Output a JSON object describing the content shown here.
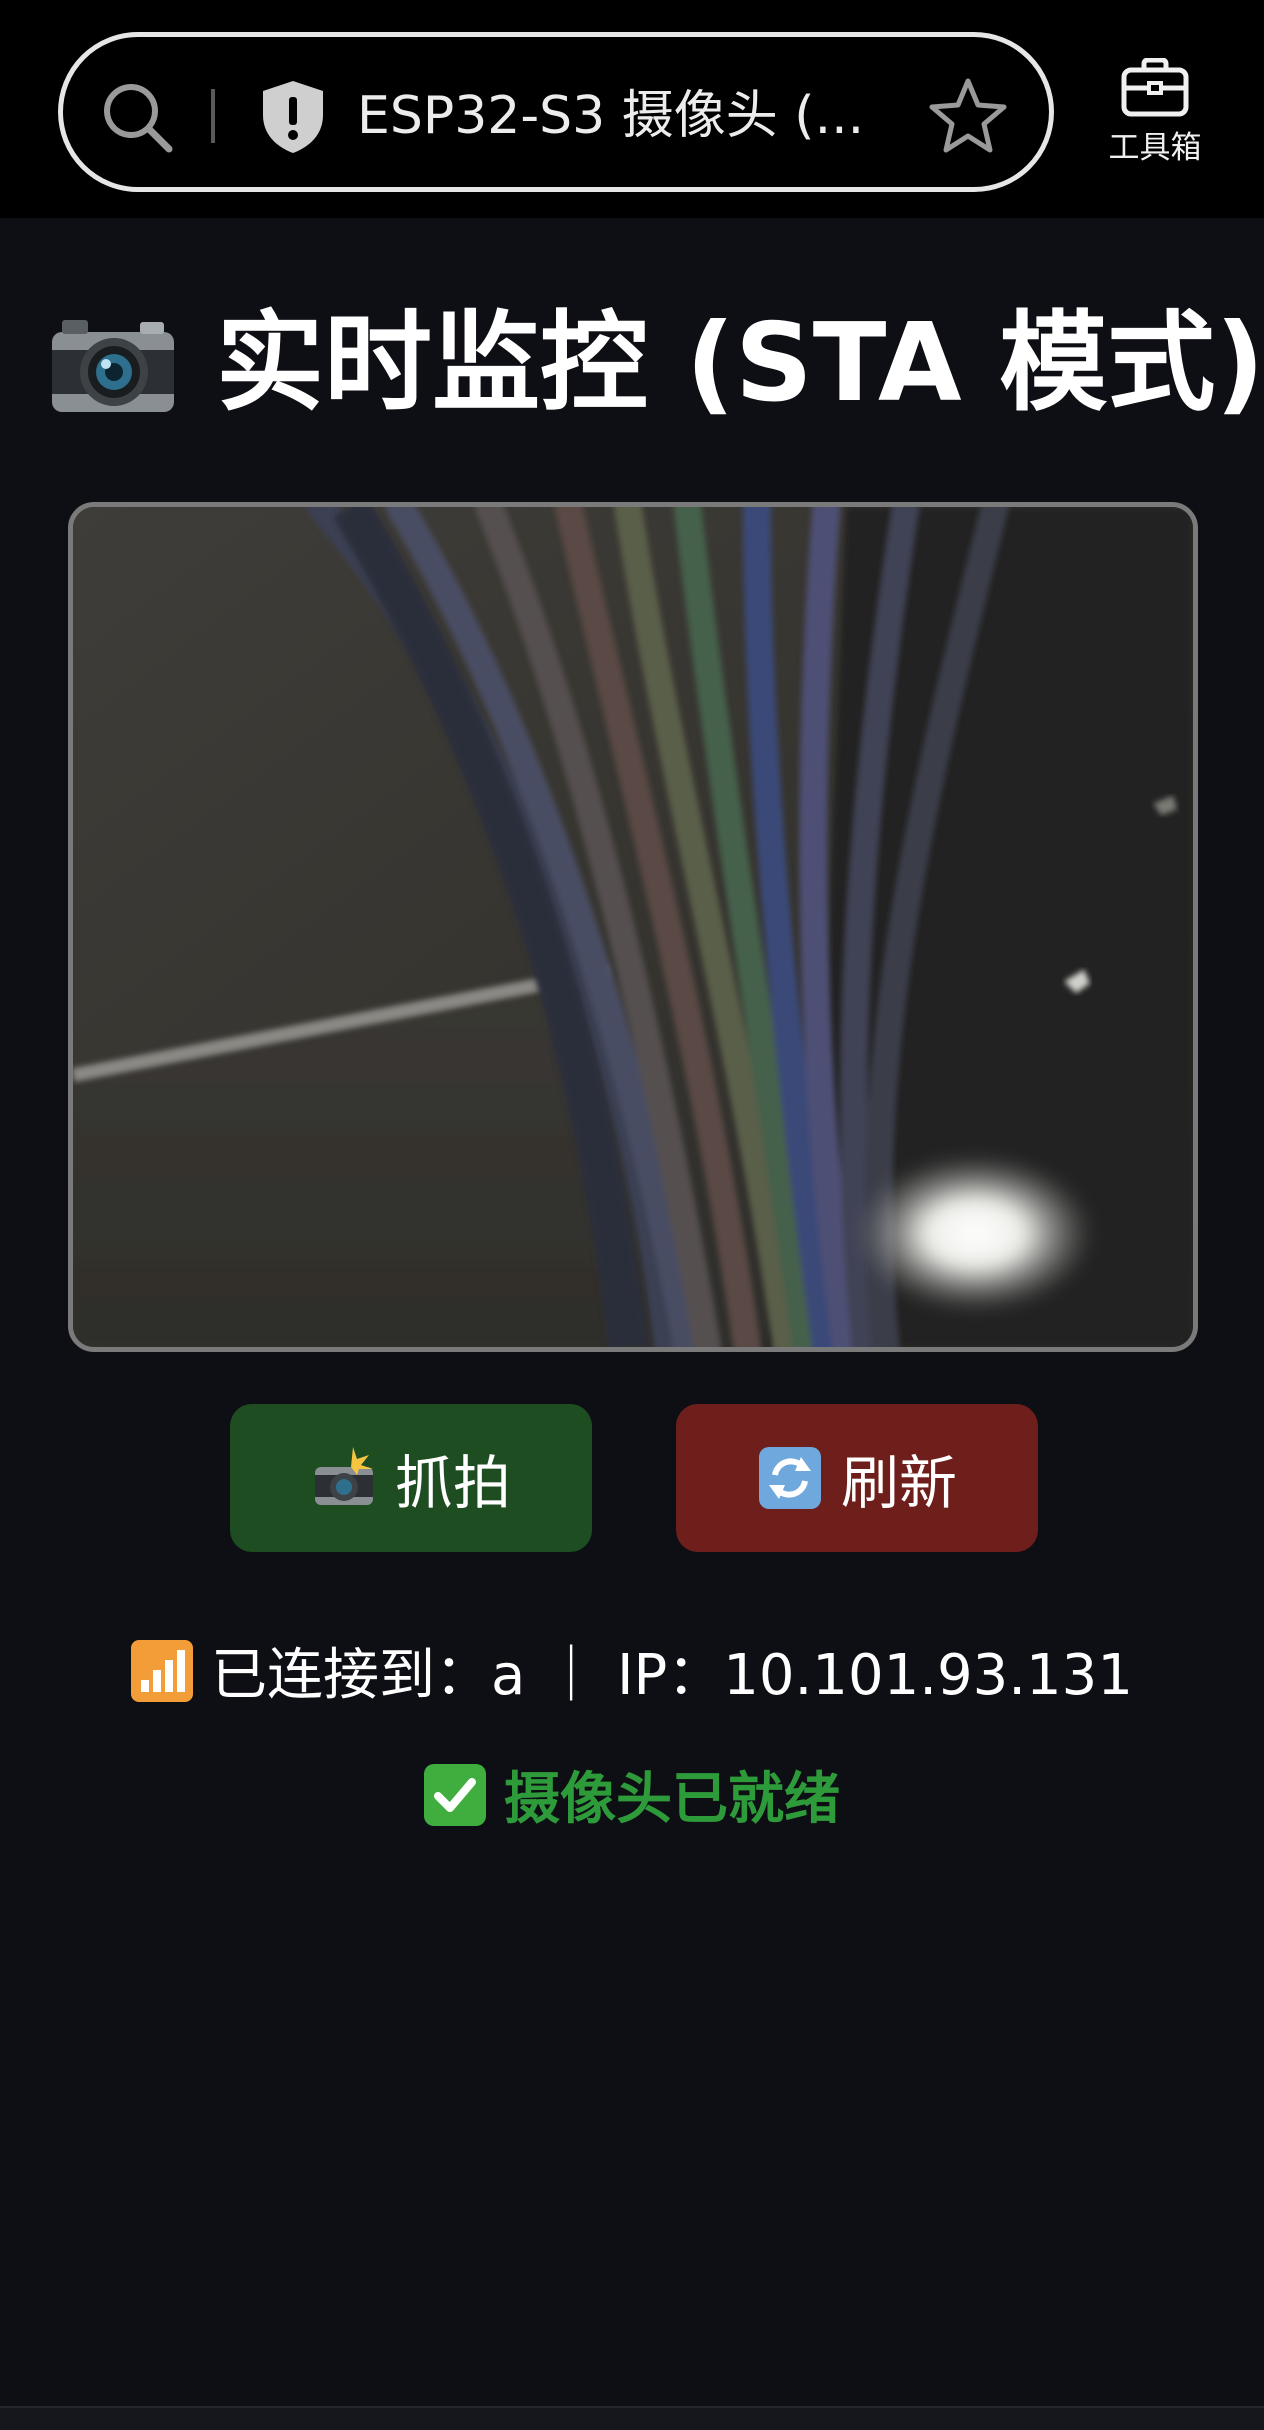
{
  "browser": {
    "tab_title": "ESP32-S3 摄像头 (...",
    "toolbox_label": "工具箱",
    "icons": [
      "search-icon",
      "shield-icon",
      "star-icon",
      "toolbox-icon"
    ]
  },
  "page": {
    "title": "实时监控 (STA 模式)",
    "title_icon": "camera-icon",
    "video_alt": "camera live stream"
  },
  "actions": {
    "capture_label": "抓拍",
    "capture_icon": "camera-flash-icon",
    "capture_color": "#1f4d22",
    "refresh_label": "刷新",
    "refresh_icon": "refresh-icon",
    "refresh_color": "#6e1f1b"
  },
  "status": {
    "connection_text": "已连接到：a ｜ IP：10.101.93.131",
    "connection_icon": "signal-bars-icon",
    "ready_text": "摄像头已就绪",
    "ready_icon": "check-mark-icon",
    "ready_color": "#2e9b3a"
  }
}
